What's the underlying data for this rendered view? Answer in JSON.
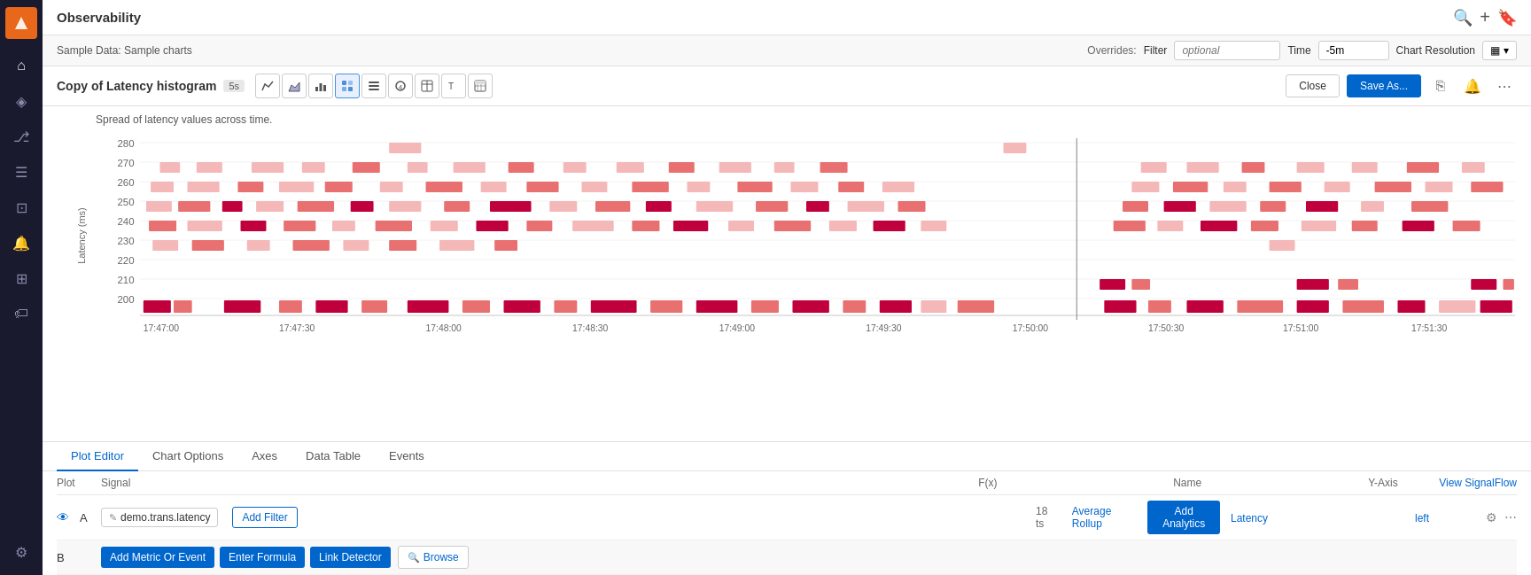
{
  "app": {
    "title": "Observability"
  },
  "topbar": {
    "sample_data_label": "Sample Data: Sample charts",
    "overrides_label": "Overrides:",
    "filter_label": "Filter",
    "filter_placeholder": "optional",
    "time_label": "Time",
    "time_value": "-5m",
    "resolution_label": "Chart Resolution"
  },
  "chart_editor": {
    "title": "Copy of Latency histogram",
    "badge": "5s",
    "subtitle": "Spread of latency values across time.",
    "close_label": "Close",
    "save_as_label": "Save As...",
    "y_axis_label": "Latency (ms)"
  },
  "chart_icons": [
    {
      "name": "line-chart-icon",
      "symbol": "📈",
      "active": false
    },
    {
      "name": "area-chart-icon",
      "symbol": "▦",
      "active": false
    },
    {
      "name": "column-chart-icon",
      "symbol": "📊",
      "active": false
    },
    {
      "name": "heatmap-icon",
      "symbol": "⊞",
      "active": true
    },
    {
      "name": "list-icon",
      "symbol": "≡",
      "active": false
    },
    {
      "name": "single-value-icon",
      "symbol": "④",
      "active": false
    },
    {
      "name": "table-icon",
      "symbol": "⊟",
      "active": false
    },
    {
      "name": "text-icon",
      "symbol": "⟵",
      "active": false
    },
    {
      "name": "dashboard-icon",
      "symbol": "⊞",
      "active": false
    }
  ],
  "tabs": [
    {
      "label": "Plot Editor",
      "active": true
    },
    {
      "label": "Chart Options",
      "active": false
    },
    {
      "label": "Axes",
      "active": false
    },
    {
      "label": "Data Table",
      "active": false
    },
    {
      "label": "Events",
      "active": false
    }
  ],
  "plot_table": {
    "headers": {
      "plot": "Plot",
      "signal": "Signal",
      "fx": "F(x)",
      "name": "Name",
      "yaxis": "Y-Axis",
      "view_signal_flow": "View SignalFlow"
    },
    "rows": [
      {
        "id": "A",
        "signal_value": "demo.trans.latency",
        "add_filter_label": "Add Filter",
        "ts_count": "18 ts",
        "rollup_label": "Average Rollup",
        "add_analytics_label": "Add Analytics",
        "name_value": "Latency",
        "yaxis_value": "left"
      }
    ],
    "row_b": {
      "id": "B",
      "add_metric_label": "Add Metric Or Event",
      "enter_formula_label": "Enter Formula",
      "link_detector_label": "Link Detector",
      "browse_label": "Browse"
    }
  },
  "sidebar": {
    "items": [
      {
        "name": "home-icon",
        "symbol": "⌂"
      },
      {
        "name": "graph-icon",
        "symbol": "◈"
      },
      {
        "name": "hierarchy-icon",
        "symbol": "⎇"
      },
      {
        "name": "list-icon",
        "symbol": "☰"
      },
      {
        "name": "dashboard-icon",
        "symbol": "⊡"
      },
      {
        "name": "alert-icon",
        "symbol": "🔔"
      },
      {
        "name": "widgets-icon",
        "symbol": "⊞"
      },
      {
        "name": "tag-icon",
        "symbol": "🏷"
      },
      {
        "name": "settings-icon",
        "symbol": "⚙"
      }
    ]
  },
  "colors": {
    "accent": "#0066cc",
    "brand": "#e8671b",
    "sidebar_bg": "#1a1a2e",
    "chart_dark": "#c0003c",
    "chart_mid": "#e87070",
    "chart_light": "#f5b8b8"
  }
}
